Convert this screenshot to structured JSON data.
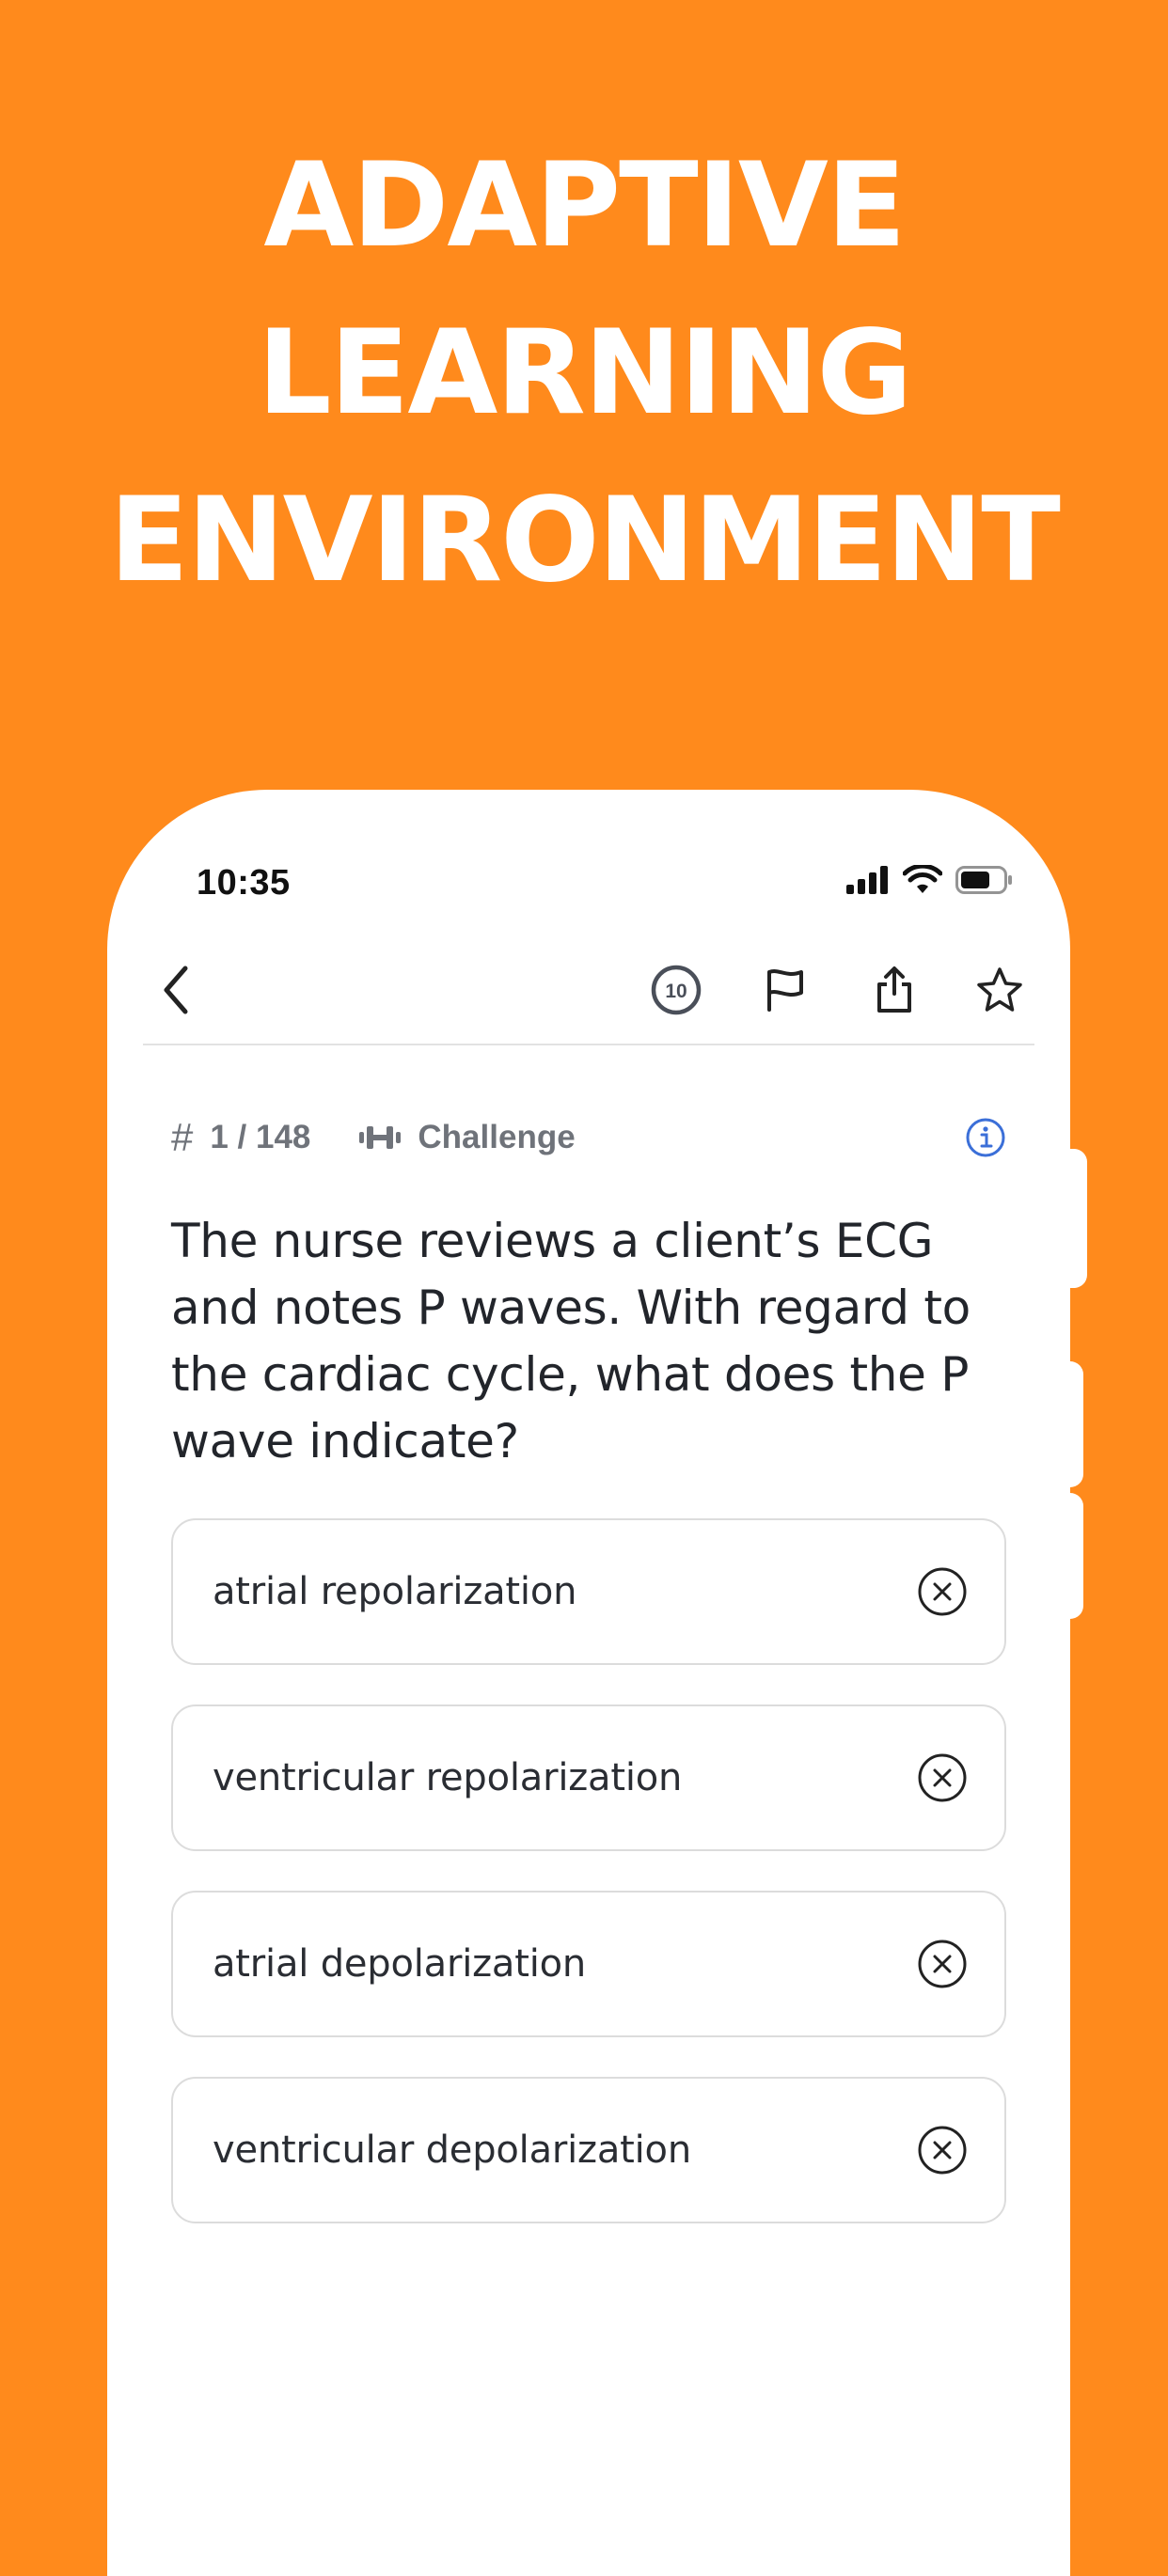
{
  "headline": {
    "lines": [
      "ADAPTIVE",
      "LEARNING",
      "ENVIRONMENT"
    ]
  },
  "status_bar": {
    "time": "10:35",
    "icons": [
      "cellular-signal-icon",
      "wifi-icon",
      "battery-icon"
    ]
  },
  "toolbar": {
    "back_icon": "chevron-left-icon",
    "timer_value": "10",
    "actions": [
      "timer-icon",
      "flag-icon",
      "share-icon",
      "star-icon"
    ]
  },
  "question_meta": {
    "counter": "1 / 148",
    "mode": "Challenge",
    "mode_icon": "dumbbell-icon",
    "info_icon": "info-icon"
  },
  "question": {
    "text": "The nurse reviews a client’s ECG and notes P waves. With regard to the cardiac cycle, what does the P wave indicate?"
  },
  "options": [
    {
      "label": "atrial repolarization"
    },
    {
      "label": "ventricular repolarization"
    },
    {
      "label": "atrial depolarization"
    },
    {
      "label": "ventricular depolarization"
    }
  ],
  "colors": {
    "background": "#FF8A1C",
    "info_accent": "#3B6FD8",
    "text_dark": "#22252B",
    "meta_gray": "#6F737A"
  }
}
